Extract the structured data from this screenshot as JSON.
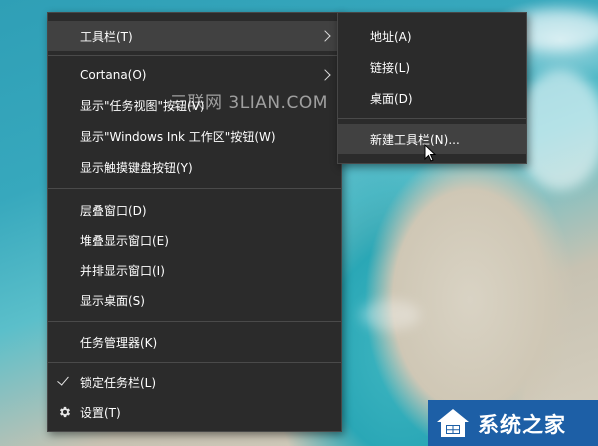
{
  "watermark": "三联网 3LIAN.COM",
  "main_menu": {
    "items": [
      {
        "label": "工具栏(T)",
        "has_submenu": true
      },
      {
        "label": "Cortana(O)",
        "has_submenu": true
      },
      {
        "label": "显示\"任务视图\"按钮(V)"
      },
      {
        "label": "显示\"Windows Ink 工作区\"按钮(W)"
      },
      {
        "label": "显示触摸键盘按钮(Y)"
      },
      {
        "label": "层叠窗口(D)"
      },
      {
        "label": "堆叠显示窗口(E)"
      },
      {
        "label": "并排显示窗口(I)"
      },
      {
        "label": "显示桌面(S)"
      },
      {
        "label": "任务管理器(K)"
      },
      {
        "label": "锁定任务栏(L)",
        "checked": true
      },
      {
        "label": "设置(T)",
        "icon": "gear-icon"
      }
    ]
  },
  "sub_menu": {
    "items": [
      {
        "label": "地址(A)"
      },
      {
        "label": "链接(L)"
      },
      {
        "label": "桌面(D)"
      },
      {
        "label": "新建工具栏(N)..."
      }
    ]
  },
  "logo": {
    "text": "系统之家"
  },
  "colors": {
    "menu_bg": "#2b2b2b",
    "menu_hover": "#414141",
    "logo_bg": "#1d5fa6"
  }
}
